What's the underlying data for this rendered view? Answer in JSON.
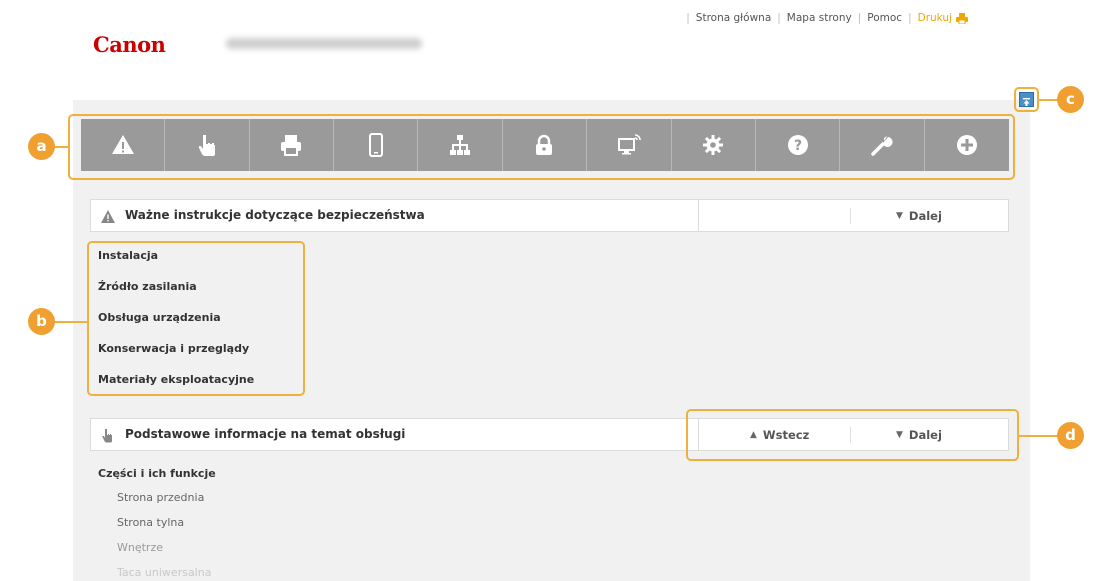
{
  "header": {
    "links": [
      {
        "label": "Strona główna"
      },
      {
        "label": "Mapa strony"
      },
      {
        "label": "Pomoc"
      },
      {
        "label": "Drukuj"
      }
    ],
    "logo": "Canon"
  },
  "toolbar": {
    "icons": [
      "warning-icon",
      "hand-icon",
      "printer-icon",
      "mobile-icon",
      "network-icon",
      "lock-icon",
      "remote-ui-icon",
      "gear-icon",
      "help-icon",
      "wrench-icon",
      "plus-icon"
    ]
  },
  "section1": {
    "title": "Ważne instrukcje dotyczące bezpieczeństwa",
    "next_label": "Dalej",
    "items": [
      "Instalacja",
      "Źródło zasilania",
      "Obsługa urządzenia",
      "Konserwacja i przeglądy",
      "Materiały eksploatacyjne"
    ]
  },
  "section2": {
    "title": "Podstawowe informacje na temat obsługi",
    "back_label": "Wstecz",
    "next_label": "Dalej",
    "heading": "Części i ich funkcje",
    "items": [
      "Strona przednia",
      "Strona tylna",
      "Wnętrze",
      "Taca uniwersalna"
    ]
  },
  "callouts": [
    "a",
    "b",
    "c",
    "d"
  ],
  "colors": {
    "brand": "#cc0000",
    "accent": "#f0a030",
    "toolbar": "#9a9a9a",
    "print_link": "#f0a800"
  }
}
